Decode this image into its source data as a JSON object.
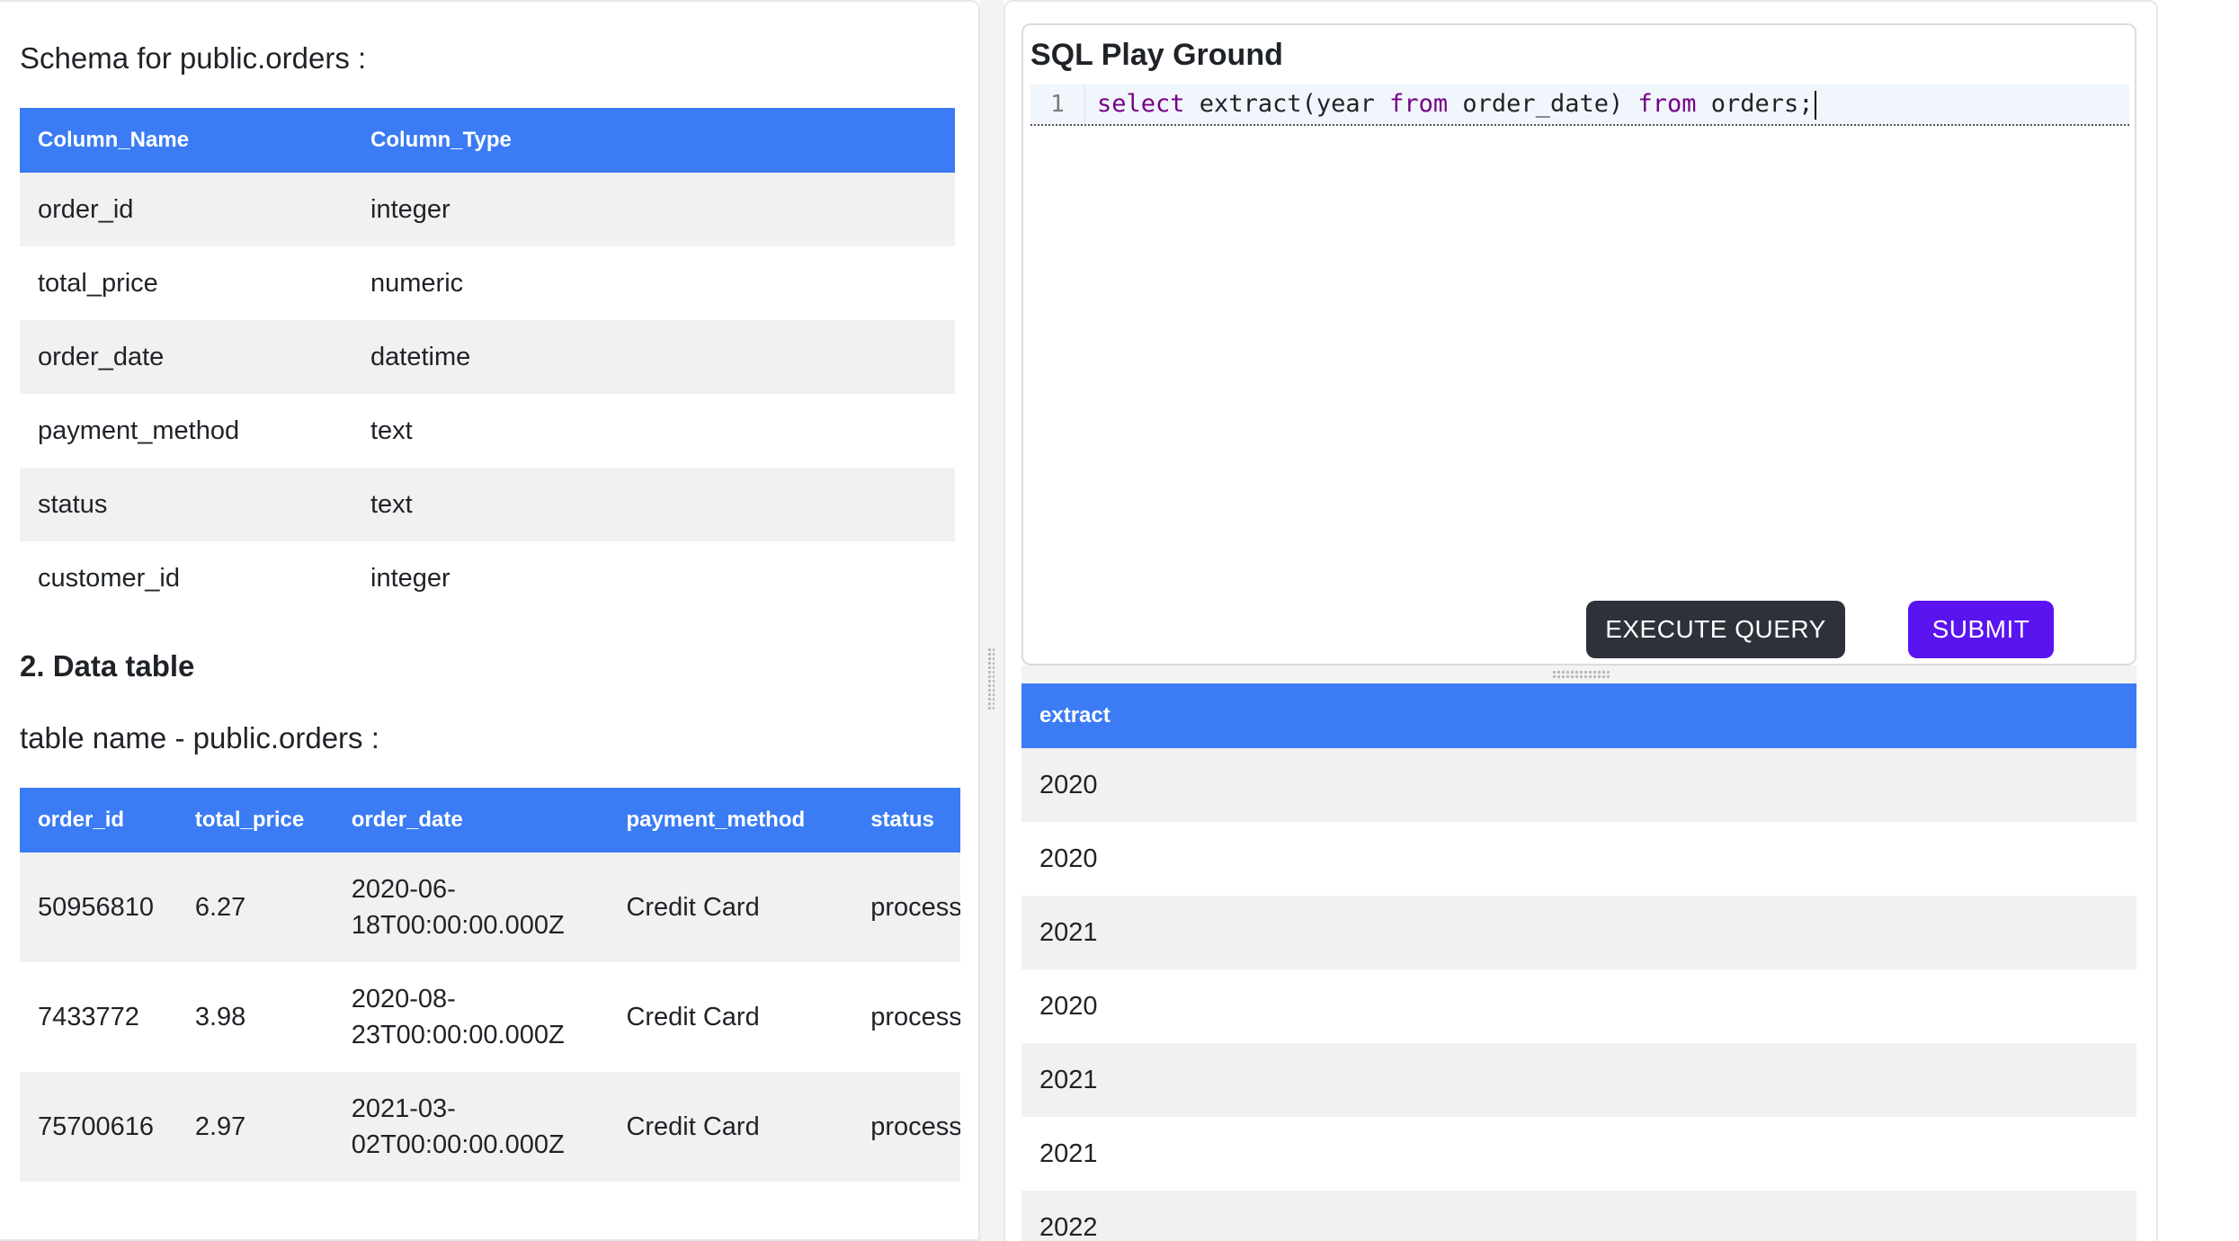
{
  "schema": {
    "title": "Schema for public.orders :",
    "headers": [
      "Column_Name",
      "Column_Type"
    ],
    "rows": [
      [
        "order_id",
        "integer"
      ],
      [
        "total_price",
        "numeric"
      ],
      [
        "order_date",
        "datetime"
      ],
      [
        "payment_method",
        "text"
      ],
      [
        "status",
        "text"
      ],
      [
        "customer_id",
        "integer"
      ]
    ]
  },
  "data_section": {
    "heading": "2. Data table",
    "table_name": "table name - public.orders :",
    "headers": [
      "order_id",
      "total_price",
      "order_date",
      "payment_method",
      "status"
    ],
    "rows": [
      [
        "50956810",
        "6.27",
        "2020-06-18T00:00:00.000Z",
        "Credit Card",
        "processed"
      ],
      [
        "7433772",
        "3.98",
        "2020-08-23T00:00:00.000Z",
        "Credit Card",
        "processed"
      ],
      [
        "75700616",
        "2.97",
        "2021-03-02T00:00:00.000Z",
        "Credit Card",
        "processed"
      ]
    ]
  },
  "editor": {
    "title": "SQL Play Ground",
    "line_number": "1",
    "code_tokens": [
      {
        "text": "select",
        "kw": true
      },
      {
        "text": " extract(year ",
        "kw": false
      },
      {
        "text": "from",
        "kw": true
      },
      {
        "text": " order_date) ",
        "kw": false
      },
      {
        "text": "from",
        "kw": true
      },
      {
        "text": " orders;",
        "kw": false
      }
    ],
    "execute_label": "EXECUTE QUERY",
    "submit_label": "SUBMIT"
  },
  "result": {
    "headers": [
      "extract"
    ],
    "rows": [
      [
        "2020"
      ],
      [
        "2020"
      ],
      [
        "2021"
      ],
      [
        "2020"
      ],
      [
        "2021"
      ],
      [
        "2021"
      ],
      [
        "2022"
      ]
    ]
  },
  "colors": {
    "header_blue": "#3b7cf5",
    "execute_button": "#2d3139",
    "submit_button": "#5a14f0",
    "keyword": "#770088"
  }
}
